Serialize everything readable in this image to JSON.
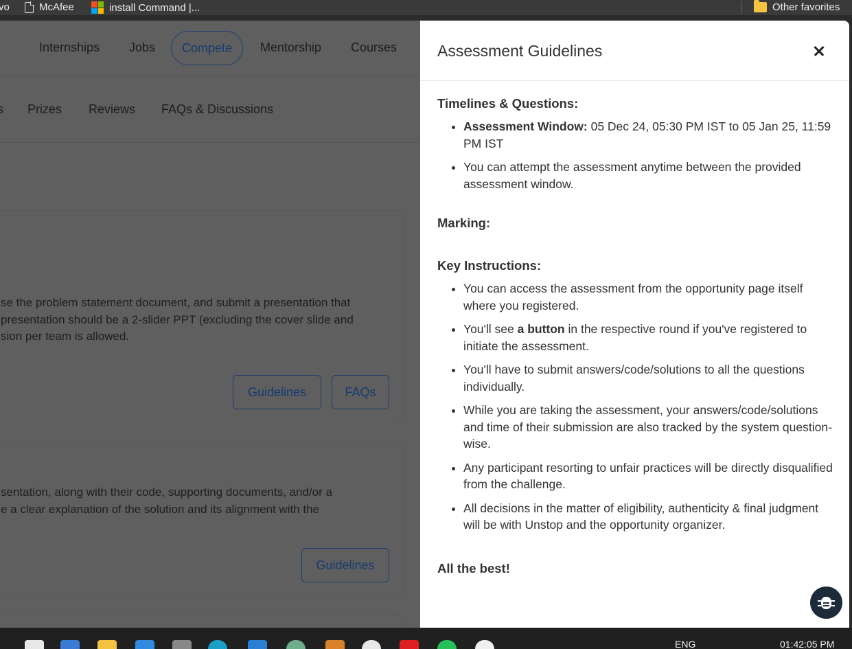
{
  "favorites": {
    "items": [
      {
        "label": "vo"
      },
      {
        "label": "McAfee"
      },
      {
        "label": "install Command |..."
      }
    ],
    "other_label": "Other favorites"
  },
  "page": {
    "nav": [
      "Internships",
      "Jobs",
      "Compete",
      "Mentorship",
      "Courses"
    ],
    "subnav": [
      "s",
      "Prizes",
      "Reviews",
      "FAQs & Discussions"
    ],
    "card1": {
      "lines": [
        "se the problem statement document, and submit a presentation that",
        "presentation should be a 2-slider PPT (excluding the cover slide and",
        "sion per team is allowed."
      ],
      "guidelines_label": "Guidelines",
      "faqs_label": "FAQs"
    },
    "card2": {
      "lines": [
        "sentation, along with their code, supporting documents, and/or a",
        "e a clear explanation of the solution and its alignment with the"
      ],
      "guidelines_label": "Guidelines"
    }
  },
  "drawer": {
    "title": "Assessment Guidelines",
    "section1": {
      "heading": "Timelines & Questions:",
      "window_label": "Assessment Window:",
      "window_value": " 05 Dec 24, 05:30 PM IST to 05 Jan 25, 11:59 PM IST",
      "item2": "You can attempt the assessment anytime between the provided assessment window."
    },
    "section2": {
      "heading": "Marking:"
    },
    "section3": {
      "heading": "Key Instructions:",
      "item1": "You can access the assessment from the opportunity page itself where you registered.",
      "item2_pre": "You'll see ",
      "item2_bold": "a button",
      "item2_post": " in the respective round if you've registered to initiate the assessment.",
      "item3": "You'll have to submit answers/code/solutions to all the questions individually.",
      "item4": "While you are taking the assessment, your answers/code/solutions and time of their submission are also tracked by the system question-wise.",
      "item5": "Any participant resorting to unfair practices will be directly disqualified from the challenge.",
      "item6": "All decisions in the matter of eligibility, authenticity & final judgment will be with Unstop and the opportunity organizer."
    },
    "closing": "All the best!"
  },
  "taskbar": {
    "language": "ENG",
    "time": "01:42:05 PM"
  }
}
